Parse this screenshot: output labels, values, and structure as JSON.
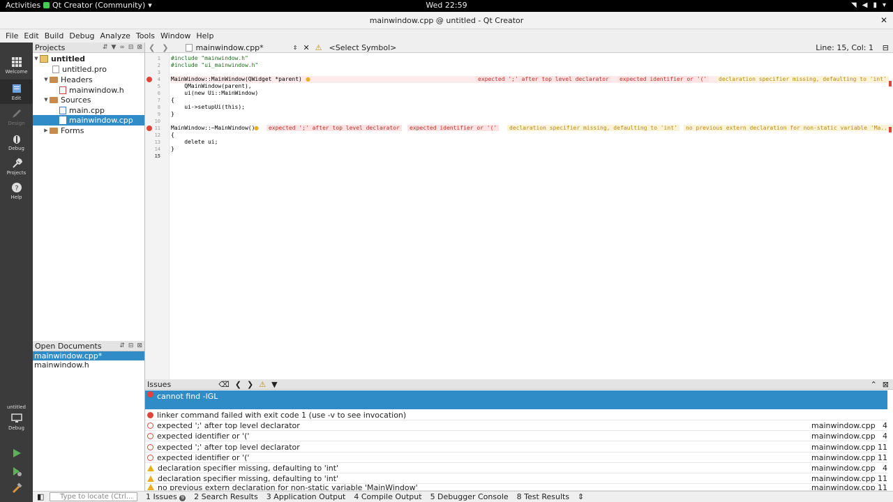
{
  "system": {
    "activities": "Activities",
    "app_menu": "Qt Creator (Community)",
    "clock": "Wed 22:59"
  },
  "window": {
    "title": "mainwindow.cpp @ untitled - Qt Creator"
  },
  "menu": [
    "File",
    "Edit",
    "Build",
    "Debug",
    "Analyze",
    "Tools",
    "Window",
    "Help"
  ],
  "modes": {
    "welcome": "Welcome",
    "edit": "Edit",
    "design": "Design",
    "debug": "Debug",
    "projects": "Projects",
    "help": "Help",
    "kit_project": "untitled",
    "kit_mode": "Debug"
  },
  "projects": {
    "header": "Projects",
    "tree": [
      {
        "label": "untitled"
      },
      {
        "label": "untitled.pro"
      },
      {
        "label": "Headers"
      },
      {
        "label": "mainwindow.h"
      },
      {
        "label": "Sources"
      },
      {
        "label": "main.cpp"
      },
      {
        "label": "mainwindow.cpp"
      },
      {
        "label": "Forms"
      }
    ]
  },
  "open_documents": {
    "header": "Open Documents",
    "items": [
      "mainwindow.cpp*",
      "mainwindow.h"
    ]
  },
  "editor_toolbar": {
    "file": "mainwindow.cpp*",
    "symbol": "<Select Symbol>",
    "position": "Line: 15, Col: 1"
  },
  "code": {
    "lines": [
      {
        "n": "1",
        "text": "#include \"mainwindow.h\""
      },
      {
        "n": "2",
        "text": "#include \"ui_mainwindow.h\""
      },
      {
        "n": "3",
        "text": ""
      },
      {
        "n": "4",
        "text": "MainWindow::MainWindow(QWidget *parent) :"
      },
      {
        "n": "5",
        "text": "    QMainWindow(parent),"
      },
      {
        "n": "6",
        "text": "    ui(new Ui::MainWindow)"
      },
      {
        "n": "7",
        "text": "{"
      },
      {
        "n": "8",
        "text": "    ui->setupUi(this);"
      },
      {
        "n": "9",
        "text": "}"
      },
      {
        "n": "10",
        "text": ""
      },
      {
        "n": "11",
        "text": "MainWindow::~MainWindow()"
      },
      {
        "n": "12",
        "text": "{"
      },
      {
        "n": "13",
        "text": "    delete ui;"
      },
      {
        "n": "14",
        "text": "}"
      },
      {
        "n": "15",
        "text": ""
      }
    ],
    "inline_diag_line4": [
      "expected ';' after top level declarator",
      "expected identifier or '('",
      "declaration specifier missing, defaulting to 'int'"
    ],
    "inline_diag_line11": [
      "expected ';' after top level declarator",
      "expected identifier or '('",
      "declaration specifier missing, defaulting to 'int'",
      "no previous extern declaration for non-static variable 'Ma..."
    ]
  },
  "issues": {
    "header": "Issues",
    "rows": [
      {
        "text": "cannot find -lGL",
        "file": "",
        "line": ""
      },
      {
        "text": "linker command failed with exit code 1 (use -v to see invocation)",
        "file": "",
        "line": ""
      },
      {
        "text": "expected ';' after top level declarator",
        "file": "mainwindow.cpp",
        "line": "4"
      },
      {
        "text": "expected identifier or '('",
        "file": "mainwindow.cpp",
        "line": "4"
      },
      {
        "text": "expected ';' after top level declarator",
        "file": "mainwindow.cpp",
        "line": "11"
      },
      {
        "text": "expected identifier or '('",
        "file": "mainwindow.cpp",
        "line": "11"
      },
      {
        "text": "declaration specifier missing, defaulting to 'int'",
        "file": "mainwindow.cpp",
        "line": "4"
      },
      {
        "text": "declaration specifier missing, defaulting to 'int'",
        "file": "mainwindow.cpp",
        "line": "11"
      },
      {
        "text": "no previous extern declaration for non-static variable 'MainWindow'",
        "file": "mainwindow.cpp",
        "line": "11"
      }
    ]
  },
  "statusbar": {
    "locate_placeholder": "Type to locate (Ctrl...",
    "tabs": [
      "1 Issues",
      "2 Search Results",
      "3 Application Output",
      "4 Compile Output",
      "5 Debugger Console",
      "8 Test Results"
    ],
    "issues_badge": "9"
  }
}
